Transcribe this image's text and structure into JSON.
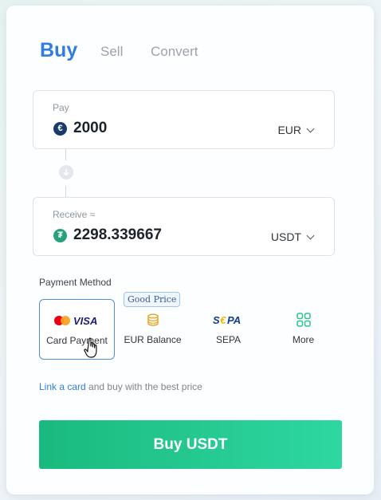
{
  "tabs": [
    {
      "label": "Buy",
      "active": true
    },
    {
      "label": "Sell",
      "active": false
    },
    {
      "label": "Convert",
      "active": false
    }
  ],
  "pay": {
    "label": "Pay",
    "amount": "2000",
    "currency": "EUR",
    "coin_icon": "euro-icon",
    "coin_color": "#1a3a6b"
  },
  "receive": {
    "label": "Receive ≈",
    "amount": "2298.339667",
    "currency": "USDT",
    "coin_icon": "tether-icon",
    "coin_color": "#26a17b"
  },
  "payment_method": {
    "title": "Payment Method",
    "badge": "Good Price",
    "options": [
      {
        "label": "Card Payment",
        "icon": "mastercard-visa-icon",
        "selected": true
      },
      {
        "label": "EUR Balance",
        "icon": "coin-stack-icon",
        "selected": false
      },
      {
        "label": "SEPA",
        "icon": "sepa-logo",
        "selected": false
      },
      {
        "label": "More",
        "icon": "grid-icon",
        "selected": false
      }
    ]
  },
  "hint": {
    "link": "Link a card",
    "text": " and buy with the best price"
  },
  "buy_button": {
    "label": "Buy USDT"
  },
  "colors": {
    "accent": "#2f7de1",
    "button_start": "#1aba7e",
    "button_end": "#2ed7a1"
  }
}
